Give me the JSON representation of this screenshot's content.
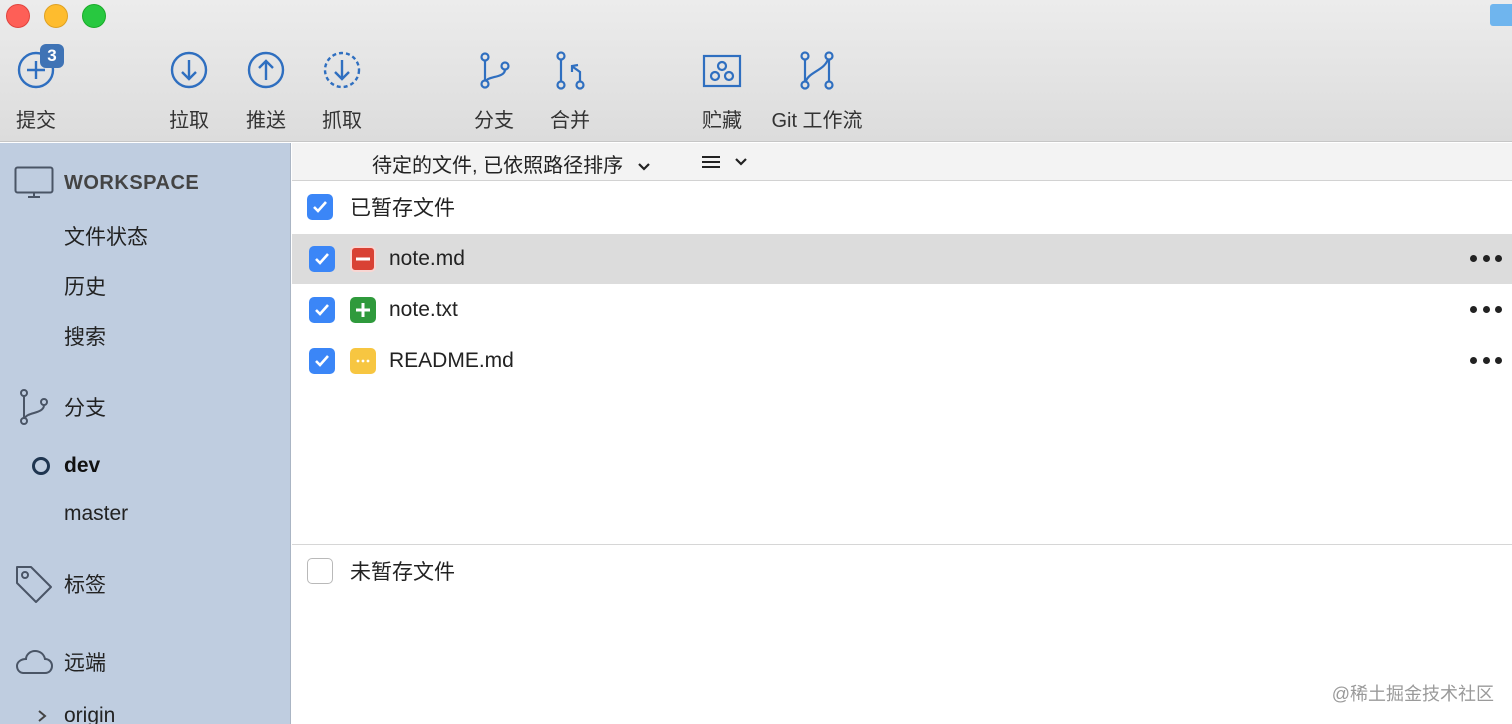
{
  "toolbar": {
    "commit": {
      "label": "提交",
      "badge": "3"
    },
    "pull": {
      "label": "拉取"
    },
    "push": {
      "label": "推送"
    },
    "fetch": {
      "label": "抓取"
    },
    "branch": {
      "label": "分支"
    },
    "merge": {
      "label": "合并"
    },
    "stash": {
      "label": "贮藏"
    },
    "gitflow": {
      "label": "Git 工作流"
    }
  },
  "sidebar": {
    "workspace": {
      "title": "WORKSPACE",
      "items": [
        "文件状态",
        "历史",
        "搜索"
      ]
    },
    "branches": {
      "title": "分支",
      "current": "dev",
      "items": [
        "dev",
        "master"
      ]
    },
    "tags": {
      "title": "标签"
    },
    "remotes": {
      "title": "远端",
      "items": [
        "origin"
      ]
    }
  },
  "main": {
    "sort_label": "待定的文件, 已依照路径排序",
    "staged": {
      "label": "已暂存文件",
      "files": [
        {
          "name": "note.md",
          "status": "deleted",
          "checked": true
        },
        {
          "name": "note.txt",
          "status": "added",
          "checked": true
        },
        {
          "name": "README.md",
          "status": "modified",
          "checked": true
        }
      ]
    },
    "unstaged": {
      "label": "未暂存文件"
    }
  },
  "watermark": "@稀土掘金技术社区",
  "colors": {
    "sidebar_bg": "#bfcde0",
    "accent_blue": "#3b86f7",
    "deleted": "#d94134",
    "added": "#2f9a3c",
    "modified": "#f7c641",
    "icon_blue": "#2f6fc0"
  }
}
